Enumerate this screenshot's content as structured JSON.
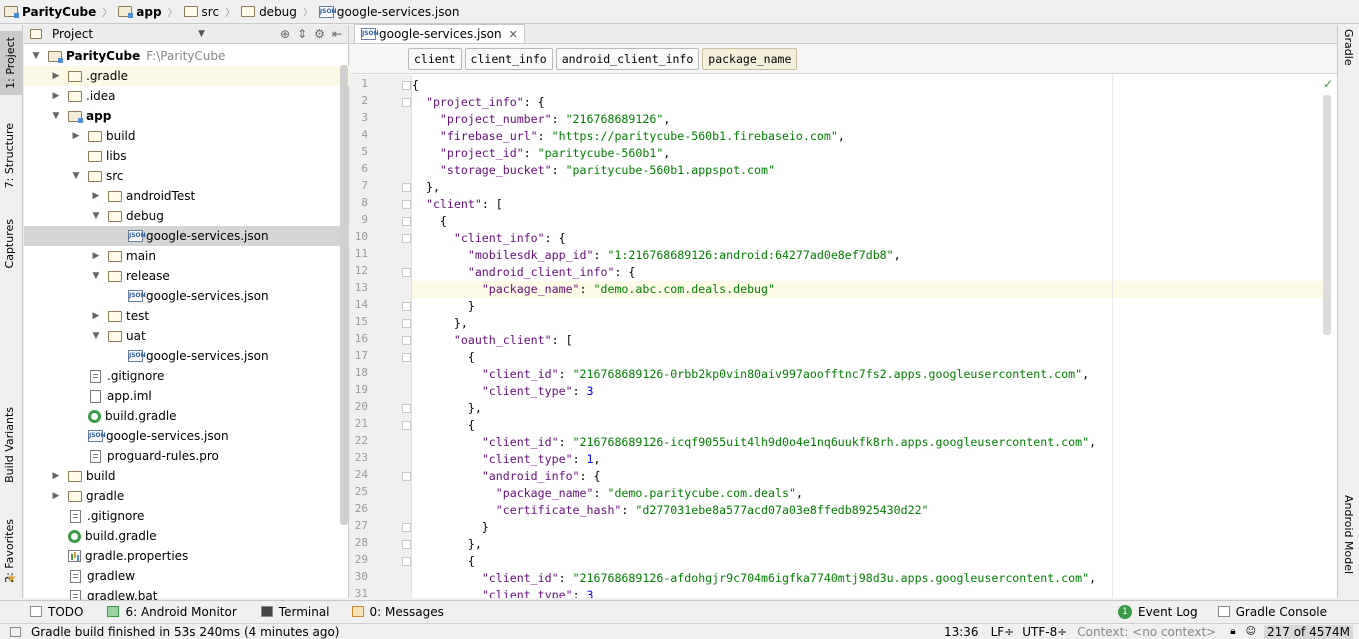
{
  "breadcrumbs": [
    "ParityCube",
    "app",
    "src",
    "debug",
    "google-services.json"
  ],
  "left_tool_tabs": [
    "1: Project",
    "7: Structure",
    "Captures",
    "Build Variants",
    "2: Favorites"
  ],
  "right_tool_tabs": [
    "Gradle",
    "Android Model"
  ],
  "project_panel": {
    "view_mode": "Project",
    "tree": [
      {
        "label": "ParityCube",
        "path": "F:\\ParityCube",
        "depth": 0,
        "expanded": true,
        "icon": "folder-module-icon"
      },
      {
        "label": ".gradle",
        "depth": 1,
        "expanded": false,
        "icon": "folder-icon"
      },
      {
        "label": ".idea",
        "depth": 1,
        "expanded": false,
        "icon": "folder-icon"
      },
      {
        "label": "app",
        "depth": 1,
        "expanded": true,
        "icon": "folder-module-icon",
        "bold": true
      },
      {
        "label": "build",
        "depth": 2,
        "expanded": false,
        "icon": "folder-icon"
      },
      {
        "label": "libs",
        "depth": 2,
        "leaf": true,
        "icon": "folder-icon"
      },
      {
        "label": "src",
        "depth": 2,
        "expanded": true,
        "icon": "folder-icon"
      },
      {
        "label": "androidTest",
        "depth": 3,
        "expanded": false,
        "icon": "folder-icon"
      },
      {
        "label": "debug",
        "depth": 3,
        "expanded": true,
        "icon": "folder-icon"
      },
      {
        "label": "google-services.json",
        "depth": 4,
        "leaf": true,
        "icon": "json-icon",
        "selected": true
      },
      {
        "label": "main",
        "depth": 3,
        "expanded": false,
        "icon": "folder-icon"
      },
      {
        "label": "release",
        "depth": 3,
        "expanded": true,
        "icon": "folder-icon"
      },
      {
        "label": "google-services.json",
        "depth": 4,
        "leaf": true,
        "icon": "json-icon"
      },
      {
        "label": "test",
        "depth": 3,
        "expanded": false,
        "icon": "folder-icon"
      },
      {
        "label": "uat",
        "depth": 3,
        "expanded": true,
        "icon": "folder-icon"
      },
      {
        "label": "google-services.json",
        "depth": 4,
        "leaf": true,
        "icon": "json-icon"
      },
      {
        "label": ".gitignore",
        "depth": 2,
        "leaf": true,
        "icon": "text-file-icon"
      },
      {
        "label": "app.iml",
        "depth": 2,
        "leaf": true,
        "icon": "iml-file-icon"
      },
      {
        "label": "build.gradle",
        "depth": 2,
        "leaf": true,
        "icon": "gradle-icon"
      },
      {
        "label": "google-services.json",
        "depth": 2,
        "leaf": true,
        "icon": "json-icon"
      },
      {
        "label": "proguard-rules.pro",
        "depth": 2,
        "leaf": true,
        "icon": "text-file-icon"
      },
      {
        "label": "build",
        "depth": 1,
        "expanded": false,
        "icon": "folder-icon"
      },
      {
        "label": "gradle",
        "depth": 1,
        "expanded": false,
        "icon": "folder-icon"
      },
      {
        "label": ".gitignore",
        "depth": 1,
        "leaf": true,
        "icon": "text-file-icon"
      },
      {
        "label": "build.gradle",
        "depth": 1,
        "leaf": true,
        "icon": "gradle-icon"
      },
      {
        "label": "gradle.properties",
        "depth": 1,
        "leaf": true,
        "icon": "properties-icon"
      },
      {
        "label": "gradlew",
        "depth": 1,
        "leaf": true,
        "icon": "text-file-icon"
      },
      {
        "label": "gradlew.bat",
        "depth": 1,
        "leaf": true,
        "icon": "text-file-icon"
      }
    ]
  },
  "editor": {
    "open_tab": "google-services.json",
    "json_path": [
      "client",
      "client_info",
      "android_client_info",
      "package_name"
    ],
    "current_line": 13,
    "lines": [
      [
        [
          "p",
          "{"
        ]
      ],
      [
        [
          "p",
          "  "
        ],
        [
          "k",
          "\"project_info\""
        ],
        [
          "p",
          ": {"
        ]
      ],
      [
        [
          "p",
          "    "
        ],
        [
          "k",
          "\"project_number\""
        ],
        [
          "p",
          ": "
        ],
        [
          "s",
          "\"216768689126\""
        ],
        [
          "p",
          ","
        ]
      ],
      [
        [
          "p",
          "    "
        ],
        [
          "k",
          "\"firebase_url\""
        ],
        [
          "p",
          ": "
        ],
        [
          "s",
          "\"https://paritycube-560b1.firebaseio.com\""
        ],
        [
          "p",
          ","
        ]
      ],
      [
        [
          "p",
          "    "
        ],
        [
          "k",
          "\"project_id\""
        ],
        [
          "p",
          ": "
        ],
        [
          "s",
          "\"paritycube-560b1\""
        ],
        [
          "p",
          ","
        ]
      ],
      [
        [
          "p",
          "    "
        ],
        [
          "k",
          "\"storage_bucket\""
        ],
        [
          "p",
          ": "
        ],
        [
          "s",
          "\"paritycube-560b1.appspot.com\""
        ]
      ],
      [
        [
          "p",
          "  },"
        ]
      ],
      [
        [
          "p",
          "  "
        ],
        [
          "k",
          "\"client\""
        ],
        [
          "p",
          ": ["
        ]
      ],
      [
        [
          "p",
          "    {"
        ]
      ],
      [
        [
          "p",
          "      "
        ],
        [
          "k",
          "\"client_info\""
        ],
        [
          "p",
          ": {"
        ]
      ],
      [
        [
          "p",
          "        "
        ],
        [
          "k",
          "\"mobilesdk_app_id\""
        ],
        [
          "p",
          ": "
        ],
        [
          "s",
          "\"1:216768689126:android:64277ad0e8ef7db8\""
        ],
        [
          "p",
          ","
        ]
      ],
      [
        [
          "p",
          "        "
        ],
        [
          "k",
          "\"android_client_info\""
        ],
        [
          "p",
          ": {"
        ]
      ],
      [
        [
          "p",
          "          "
        ],
        [
          "k",
          "\"package_name\""
        ],
        [
          "p",
          ": "
        ],
        [
          "s",
          "\"demo.abc.com.deals.debug\""
        ]
      ],
      [
        [
          "p",
          "        }"
        ]
      ],
      [
        [
          "p",
          "      },"
        ]
      ],
      [
        [
          "p",
          "      "
        ],
        [
          "k",
          "\"oauth_client\""
        ],
        [
          "p",
          ": ["
        ]
      ],
      [
        [
          "p",
          "        {"
        ]
      ],
      [
        [
          "p",
          "          "
        ],
        [
          "k",
          "\"client_id\""
        ],
        [
          "p",
          ": "
        ],
        [
          "s",
          "\"216768689126-0rbb2kp0vin80aiv997aoofftnc7fs2.apps.googleusercontent.com\""
        ],
        [
          "p",
          ","
        ]
      ],
      [
        [
          "p",
          "          "
        ],
        [
          "k",
          "\"client_type\""
        ],
        [
          "p",
          ": "
        ],
        [
          "n",
          "3"
        ]
      ],
      [
        [
          "p",
          "        },"
        ]
      ],
      [
        [
          "p",
          "        {"
        ]
      ],
      [
        [
          "p",
          "          "
        ],
        [
          "k",
          "\"client_id\""
        ],
        [
          "p",
          ": "
        ],
        [
          "s",
          "\"216768689126-icqf9055uit4lh9d0o4e1nq6uukfk8rh.apps.googleusercontent.com\""
        ],
        [
          "p",
          ","
        ]
      ],
      [
        [
          "p",
          "          "
        ],
        [
          "k",
          "\"client_type\""
        ],
        [
          "p",
          ": "
        ],
        [
          "n",
          "1"
        ],
        [
          "p",
          ","
        ]
      ],
      [
        [
          "p",
          "          "
        ],
        [
          "k",
          "\"android_info\""
        ],
        [
          "p",
          ": {"
        ]
      ],
      [
        [
          "p",
          "            "
        ],
        [
          "k",
          "\"package_name\""
        ],
        [
          "p",
          ": "
        ],
        [
          "s",
          "\"demo.paritycube.com.deals\""
        ],
        [
          "p",
          ","
        ]
      ],
      [
        [
          "p",
          "            "
        ],
        [
          "k",
          "\"certificate_hash\""
        ],
        [
          "p",
          ": "
        ],
        [
          "s",
          "\"d277031ebe8a577acd07a03e8ffedb8925430d22\""
        ]
      ],
      [
        [
          "p",
          "          }"
        ]
      ],
      [
        [
          "p",
          "        },"
        ]
      ],
      [
        [
          "p",
          "        {"
        ]
      ],
      [
        [
          "p",
          "          "
        ],
        [
          "k",
          "\"client_id\""
        ],
        [
          "p",
          ": "
        ],
        [
          "s",
          "\"216768689126-afdohgjr9c704m6igfka7740mtj98d3u.apps.googleusercontent.com\""
        ],
        [
          "p",
          ","
        ]
      ],
      [
        [
          "p",
          "          "
        ],
        [
          "k",
          "\"client_type\""
        ],
        [
          "p",
          ": "
        ],
        [
          "n",
          "3"
        ]
      ]
    ]
  },
  "bottom_tools": {
    "todo": "TODO",
    "android_monitor": "6: Android Monitor",
    "terminal": "Terminal",
    "messages": "0: Messages",
    "event_log_count": "1",
    "event_log": "Event Log",
    "gradle_console": "Gradle Console"
  },
  "status": {
    "message": "Gradle build finished in 53s 240ms (4 minutes ago)",
    "position": "13:36",
    "line_sep": "LF÷",
    "encoding": "UTF-8÷",
    "context": "Context: <no context>",
    "memory": "217 of 4574M"
  },
  "colors": {
    "keyword": "#660e7a",
    "string": "#008000",
    "number": "#0000ff",
    "selection": "#d5d5d5"
  }
}
